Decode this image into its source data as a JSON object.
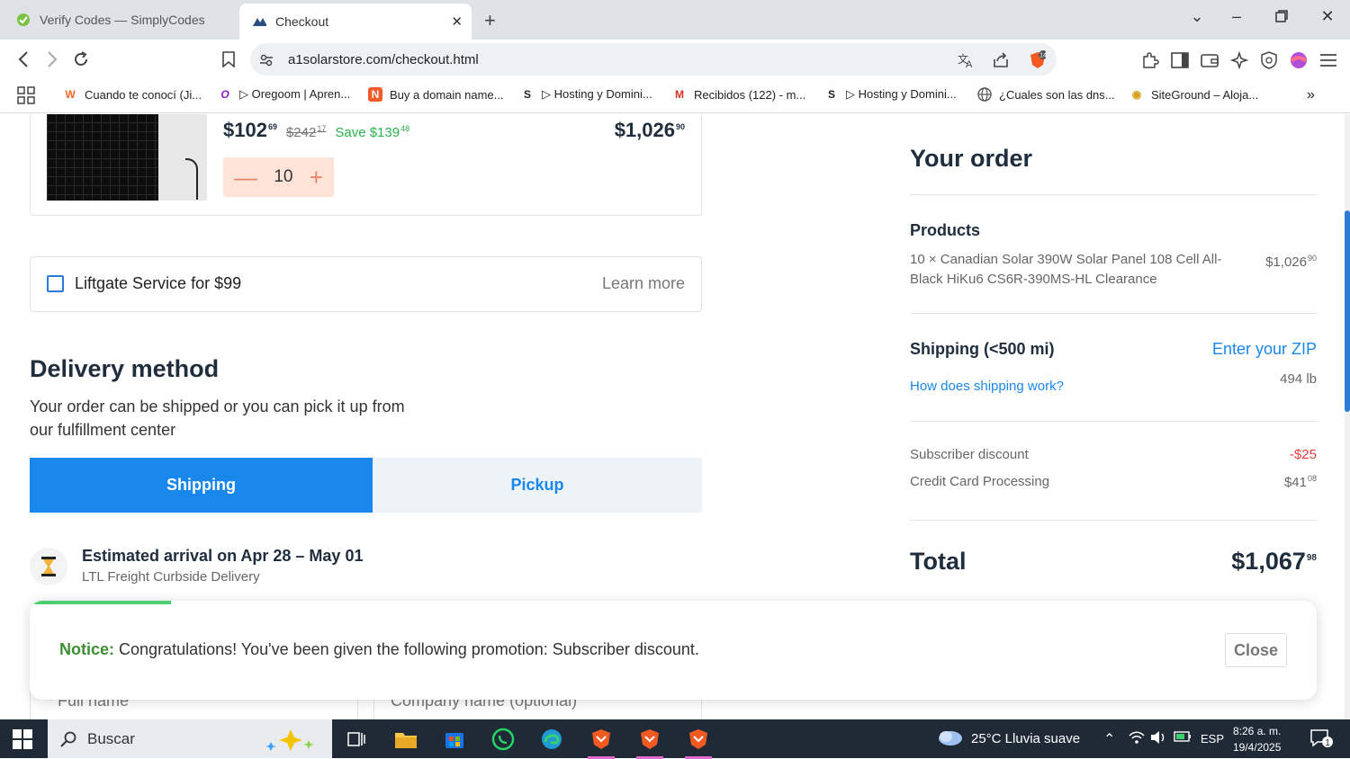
{
  "browser": {
    "tabs": [
      {
        "title": "Verify Codes — SimplyCodes",
        "active": false
      },
      {
        "title": "Checkout",
        "active": true
      }
    ],
    "url": "a1solarstore.com/checkout.html",
    "shield_count": "14",
    "bookmarks": [
      {
        "label": "Cuando te conocí (Ji...",
        "icon": "w-logo-icon"
      },
      {
        "label": "▷ Oregoom | Apren...",
        "icon": "o-logo-icon"
      },
      {
        "label": "Buy a domain name...",
        "icon": "namecheap-icon"
      },
      {
        "label": "▷ Hosting y Domini...",
        "icon": "s-logo-icon"
      },
      {
        "label": "Recibidos (122) - m...",
        "icon": "gmail-icon"
      },
      {
        "label": "▷ Hosting y Domini...",
        "icon": "s-logo-icon"
      },
      {
        "label": "¿Cuales son las dns...",
        "icon": "globe-icon"
      },
      {
        "label": "SiteGround – Aloja...",
        "icon": "siteground-icon"
      }
    ]
  },
  "product": {
    "price": "$102",
    "price_cents": "69",
    "old_price": "$242",
    "old_cents": "17",
    "save": "Save $139",
    "save_cents": "48",
    "line_total": "$1,026",
    "line_total_cents": "90",
    "quantity": "10"
  },
  "liftgate": {
    "label": "Liftgate Service for $99",
    "learn_more": "Learn more",
    "checked": false
  },
  "delivery": {
    "title": "Delivery method",
    "description": "Your order can be shipped or you can pick it up from our fulfillment center",
    "tab_shipping": "Shipping",
    "tab_pickup": "Pickup",
    "eta_title": "Estimated arrival on Apr 28 – May 01",
    "eta_sub": "LTL Freight Curbside Delivery"
  },
  "form": {
    "full_name": "* Full name",
    "company": "Company name (optional)"
  },
  "summary": {
    "title": "Your order",
    "products_label": "Products",
    "product_line": "10 × Canadian Solar 390W Solar Panel 108 Cell All-Black HiKu6 CS6R-390MS-HL Clearance",
    "product_amount": "$1,026",
    "product_cents": "90",
    "shipping_label": "Shipping (<500 mi)",
    "enter_zip": "Enter your ZIP",
    "how_shipping": "How does shipping work?",
    "weight": "494 lb",
    "discount_label": "Subscriber discount",
    "discount_value": "-$25",
    "cc_label": "Credit Card Processing",
    "cc_value": "$41",
    "cc_cents": "08",
    "total_label": "Total",
    "total_value": "$1,067",
    "total_cents": "98"
  },
  "notice": {
    "label": "Notice:",
    "message": "Congratulations! You've been given the following promotion: Subscriber discount.",
    "close": "Close",
    "progress": 0.11
  },
  "taskbar": {
    "search_placeholder": "Buscar",
    "weather": "25°C  Lluvia suave",
    "lang": "ESP",
    "time": "8:26 a. m.",
    "date": "19/4/2025",
    "notifications": "1"
  },
  "colors": {
    "accent": "#1a87ec",
    "save_green": "#2bb24c",
    "discount_red": "#e23b3b",
    "notice_green": "#3d8f34"
  }
}
